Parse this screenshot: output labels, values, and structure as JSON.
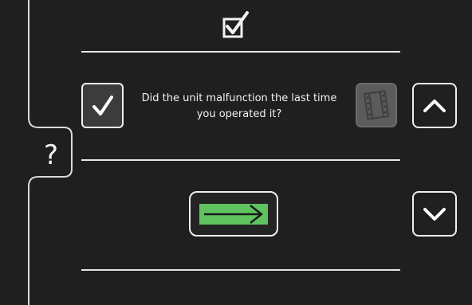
{
  "question": {
    "text": "Did the unit malfunction the last time you operated it?"
  },
  "help": {
    "label": "?"
  },
  "icons": {
    "header": "checkbox-checked-icon",
    "answer": "checkmark-icon",
    "video": "film-icon",
    "up": "chevron-up-icon",
    "down": "chevron-down-icon",
    "next": "arrow-right-icon"
  },
  "colors": {
    "background": "#1f1f1f",
    "foreground": "#f2f2f2",
    "next_fill": "#5fc45f",
    "disabled": "#5b5b5b"
  }
}
